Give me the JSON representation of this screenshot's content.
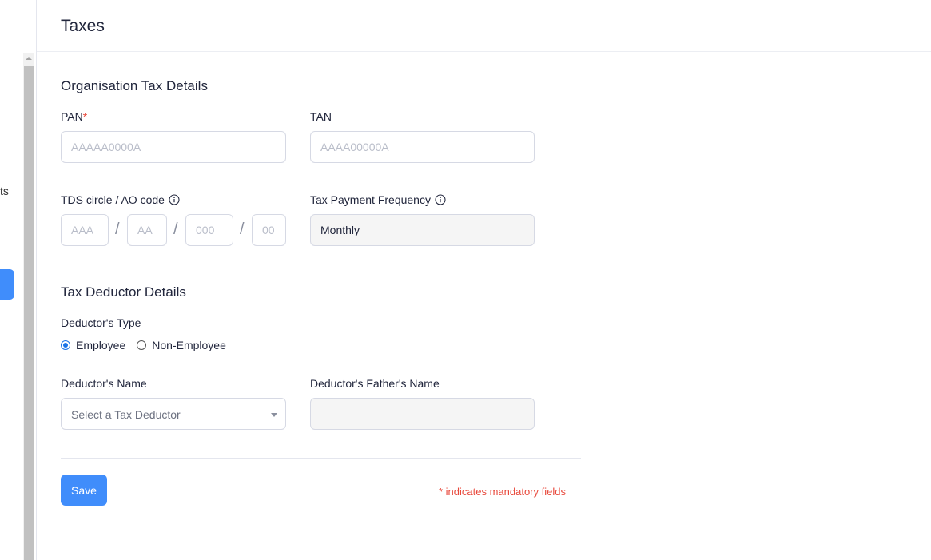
{
  "sidebar": {
    "partial_text": "ts"
  },
  "header": {
    "title": "Taxes"
  },
  "org_section": {
    "title": "Organisation Tax Details",
    "pan": {
      "label": "PAN",
      "required_mark": "*",
      "placeholder": "AAAAA0000A",
      "value": ""
    },
    "tan": {
      "label": "TAN",
      "placeholder": "AAAA00000A",
      "value": ""
    },
    "tds": {
      "label": "TDS circle / AO code",
      "separator": "/",
      "parts": [
        {
          "placeholder": "AAA"
        },
        {
          "placeholder": "AA"
        },
        {
          "placeholder": "000"
        },
        {
          "placeholder": "00"
        }
      ]
    },
    "frequency": {
      "label": "Tax Payment Frequency",
      "value": "Monthly"
    }
  },
  "deductor_section": {
    "title": "Tax Deductor Details",
    "type": {
      "label": "Deductor's Type",
      "options": [
        {
          "label": "Employee",
          "selected": true
        },
        {
          "label": "Non-Employee",
          "selected": false
        }
      ]
    },
    "name": {
      "label": "Deductor's Name",
      "placeholder": "Select a Tax Deductor"
    },
    "father_name": {
      "label": "Deductor's Father's Name",
      "value": ""
    }
  },
  "footer": {
    "save_label": "Save",
    "mandatory_note": "* indicates mandatory fields"
  },
  "colors": {
    "accent": "#408dfb",
    "required": "#e8483b",
    "radio_checked": "#1a73e8"
  }
}
